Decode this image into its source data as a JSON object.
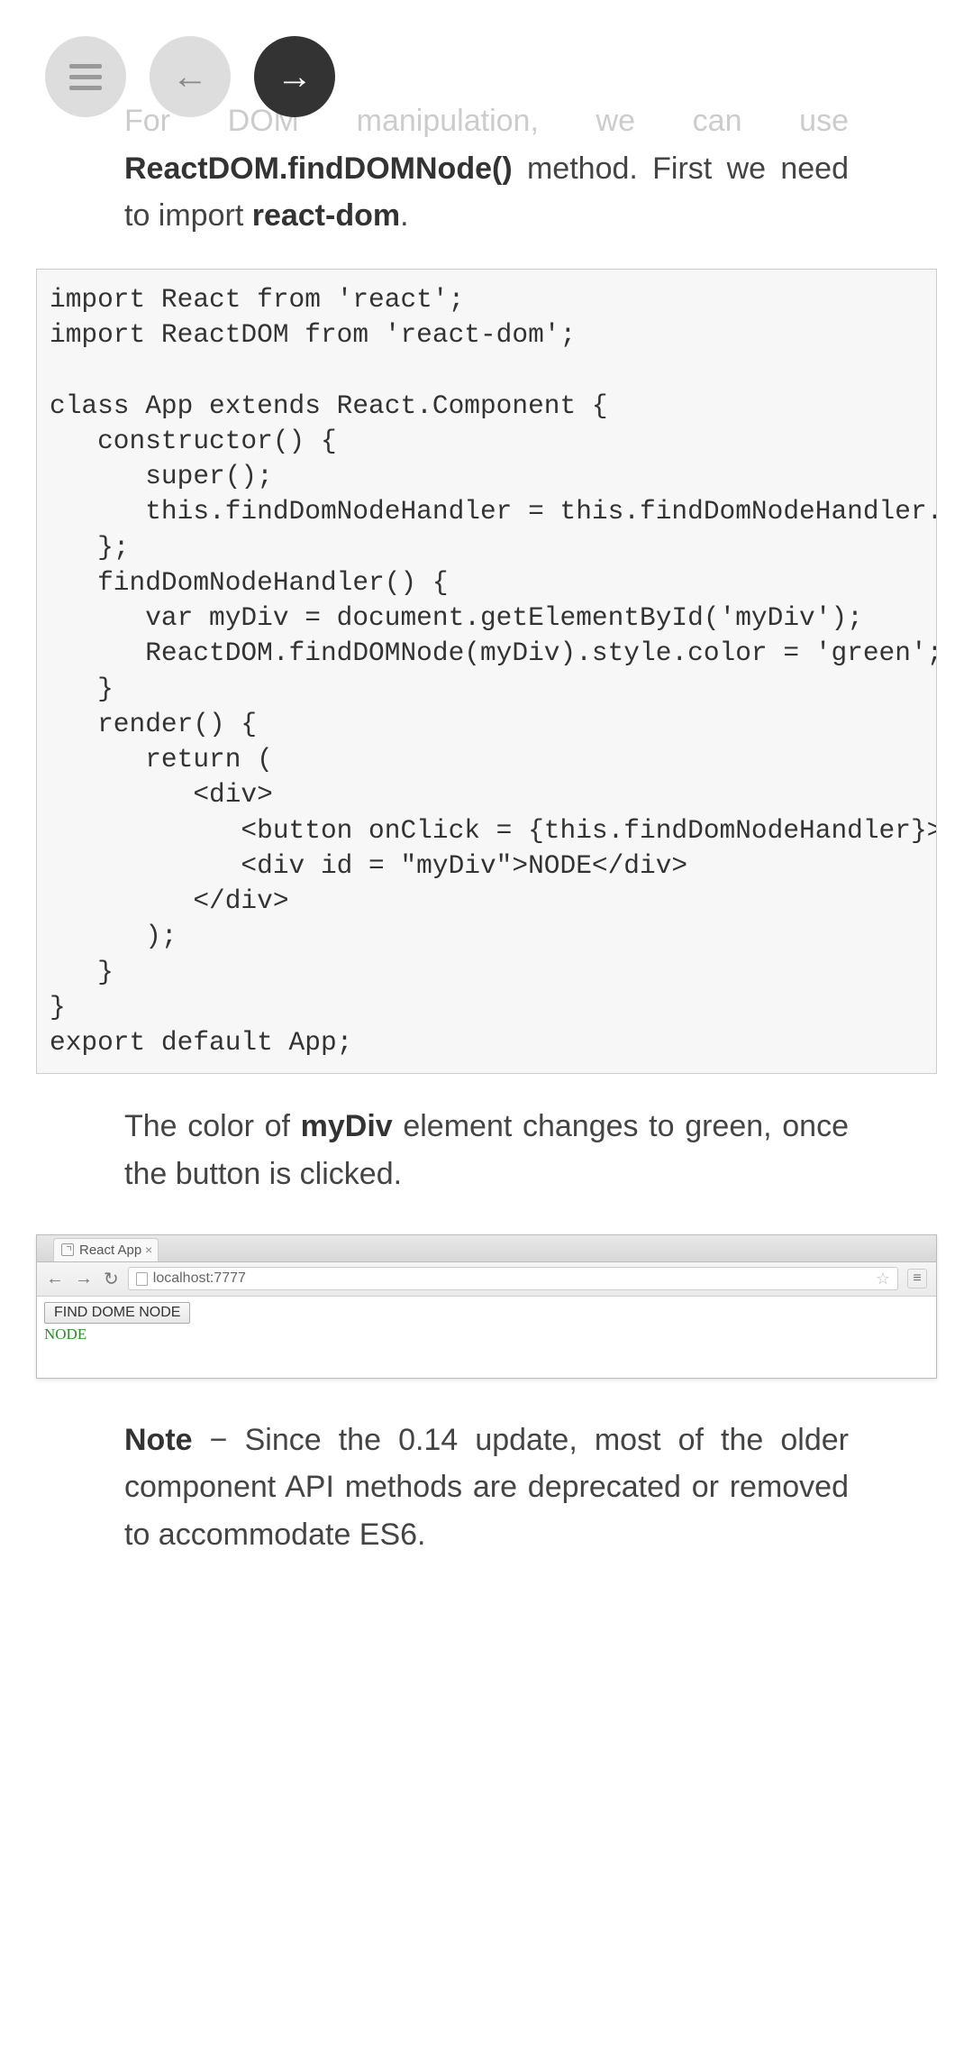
{
  "nav": {
    "prev_arrow": "←",
    "next_arrow": "→"
  },
  "intro": {
    "part1_light": "For DOM manipulation, we can use",
    "strong1": "ReactDOM.findDOMNode()",
    "part2": " method. First we need to import ",
    "strong2": "react-dom",
    "part3": "."
  },
  "code": "import React from 'react';\nimport ReactDOM from 'react-dom';\n\nclass App extends React.Component {\n   constructor() {\n      super();\n      this.findDomNodeHandler = this.findDomNodeHandler.bind(this);\n   };\n   findDomNodeHandler() {\n      var myDiv = document.getElementById('myDiv');\n      ReactDOM.findDOMNode(myDiv).style.color = 'green';\n   }\n   render() {\n      return (\n         <div>\n            <button onClick = {this.findDomNodeHandler}>FIND DOME NODE</button>\n            <div id = \"myDiv\">NODE</div>\n         </div>\n      );\n   }\n}\nexport default App;",
  "result": {
    "part1": "The color of ",
    "strong": "myDiv",
    "part2": " element changes to green, once the button is clicked."
  },
  "browser": {
    "tab_title": "React App",
    "url": "localhost:7777",
    "button_label": "FIND DOME NODE",
    "node_text": "NODE"
  },
  "note": {
    "label": "Note",
    "text": " − Since the 0.14 update, most of the older component API methods are deprecated or removed to accommodate ES6."
  }
}
